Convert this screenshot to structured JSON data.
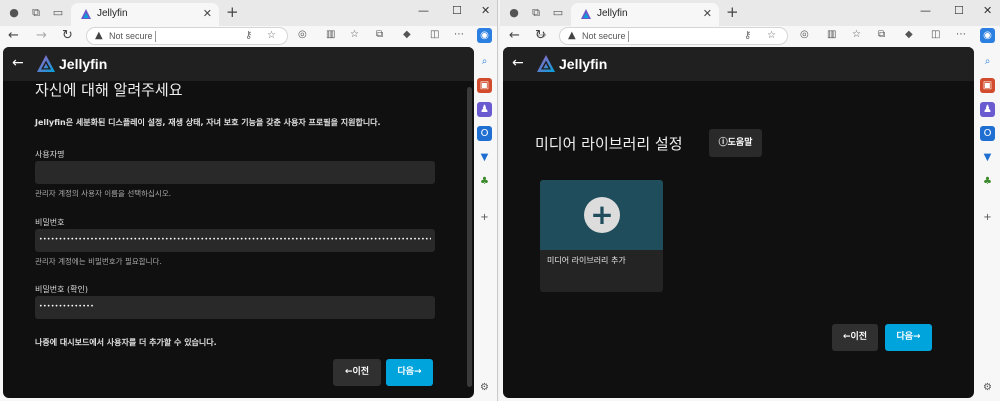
{
  "browser": {
    "tab_title": "Jellyfin",
    "new_tab_label": "+",
    "not_secure": "Not secure",
    "window_controls": [
      "—",
      "☐",
      "✕"
    ]
  },
  "left": {
    "header": {
      "back": "←",
      "logo_text": "Jellyfin"
    },
    "heading": "자신에 대해 알려주세요",
    "intro": "Jellyfin은 세분화된 디스플레이 설정, 재생 상태, 자녀 보호 기능을 갖춘 사용자 프로필을 지원합니다.",
    "username_label": "사용자명",
    "username_value": "",
    "username_help": "관리자 계정의 사용자 이름을 선택하십시오.",
    "password_label": "비밀번호",
    "password_value": "••••••••••••••••••••••••••••••••••••••••••••••••••••••••••••••••••••••••••••••••••••••••••••••••••••",
    "password_help": "관리자 계정에는 비밀번호가 필요합니다.",
    "confirm_label": "비밀번호 (확인)",
    "confirm_value": "••••••••••••••",
    "note": "나중에 대시보드에서 사용자를 더 추가할 수 있습니다.",
    "prev_label": "←이전",
    "next_label": "다음→"
  },
  "right": {
    "header": {
      "back": "←",
      "logo_text": "Jellyfin"
    },
    "heading": "미디어 라이브러리 설정",
    "help_label": "ⓘ도움말",
    "card_plus": "+",
    "card_label": "미디어 라이브러리 추가",
    "prev_label": "←이전",
    "next_label": "다음→"
  }
}
